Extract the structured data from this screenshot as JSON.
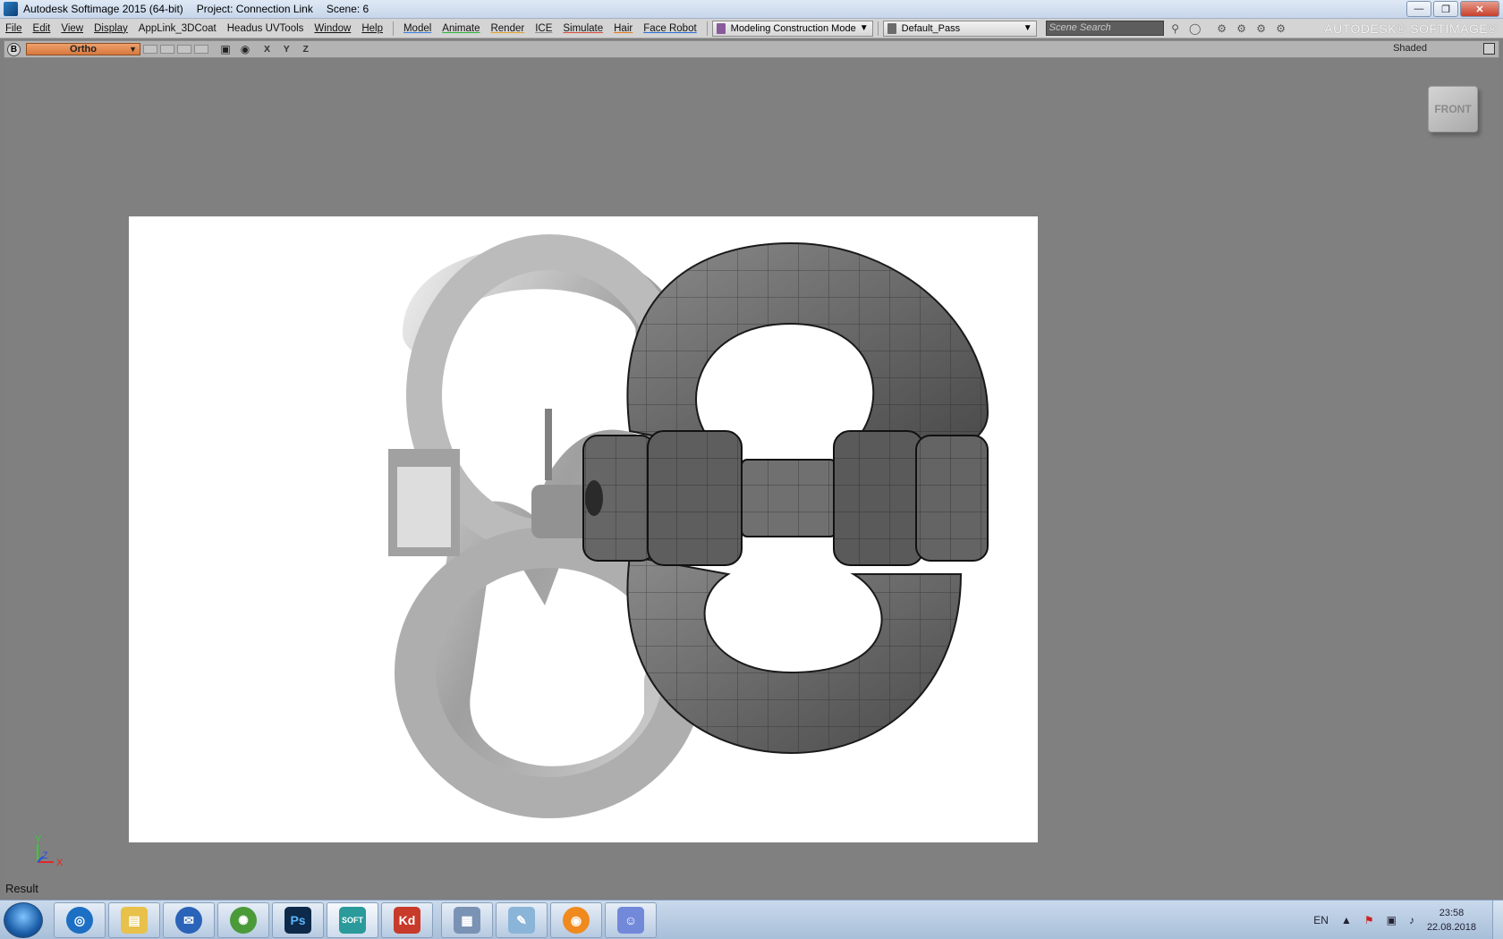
{
  "window": {
    "app_title": "Autodesk Softimage 2015 (64-bit)",
    "project": "Project: Connection Link",
    "scene": "Scene: 6",
    "minimize": "—",
    "restore": "❐",
    "close": "✕"
  },
  "menu": {
    "items": [
      "File",
      "Edit",
      "View",
      "Display",
      "AppLink_3DCoat",
      "Headus UVTools",
      "Window",
      "Help"
    ],
    "modules": [
      "Model",
      "Animate",
      "Render",
      "ICE",
      "Simulate",
      "Hair",
      "Face Robot"
    ],
    "construction_mode": "Modeling Construction Mode",
    "render_pass": "Default_Pass",
    "search_placeholder": "Scene Search",
    "brand": "AUTODESK® SOFTIMAGE®"
  },
  "viewport": {
    "b_label": "B",
    "camera": "Ortho",
    "axes_label": "X Y Z",
    "display_mode": "Shaded",
    "navcube_face": "FRONT",
    "axis_y": "Y",
    "axis_z": "Z",
    "axis_x": "X",
    "result_label": "Result"
  },
  "taskbar": {
    "apps": [
      "Firefox",
      "Explorer",
      "Thunderbird",
      "Globe",
      "Ps",
      "SOFT",
      "Kd",
      "Calculator",
      "Notes",
      "Blender",
      "Discord"
    ],
    "language": "EN",
    "time": "23:58",
    "date": "22.08.2018"
  },
  "colors": {
    "viewport_bg": "#808080",
    "camera_dropdown": "#e08a52",
    "model_gray": "#6b6b6b"
  }
}
